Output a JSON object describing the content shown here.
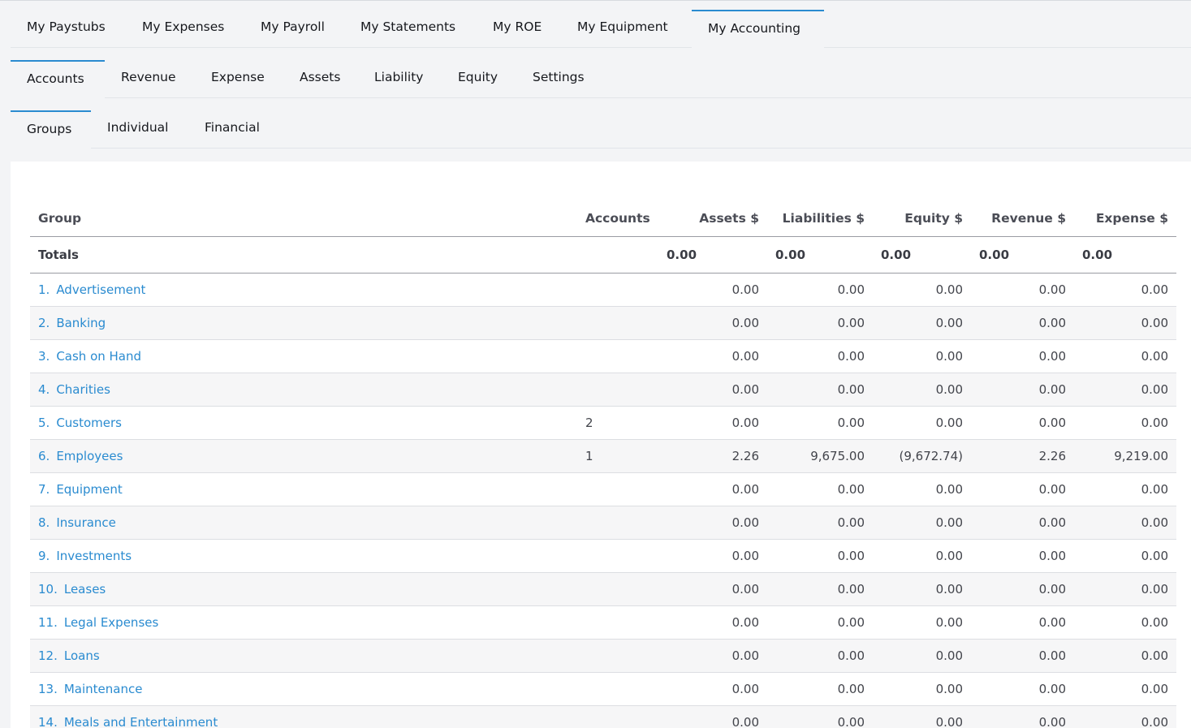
{
  "tabs_primary": [
    {
      "label": "My Paystubs"
    },
    {
      "label": "My Expenses"
    },
    {
      "label": "My Payroll"
    },
    {
      "label": "My Statements"
    },
    {
      "label": "My ROE"
    },
    {
      "label": "My Equipment"
    },
    {
      "label": "My Accounting",
      "active": true
    }
  ],
  "tabs_secondary": [
    {
      "label": "Accounts",
      "active": true
    },
    {
      "label": "Revenue"
    },
    {
      "label": "Expense"
    },
    {
      "label": "Assets"
    },
    {
      "label": "Liability"
    },
    {
      "label": "Equity"
    },
    {
      "label": "Settings"
    }
  ],
  "tabs_tertiary": [
    {
      "label": "Groups",
      "active": true
    },
    {
      "label": "Individual"
    },
    {
      "label": "Financial"
    }
  ],
  "table": {
    "headers": {
      "group": "Group",
      "accounts": "Accounts",
      "assets": "Assets $",
      "liabilities": "Liabilities $",
      "equity": "Equity $",
      "revenue": "Revenue $",
      "expense": "Expense $"
    },
    "totals": {
      "label": "Totals",
      "assets": "0.00",
      "liabilities": "0.00",
      "equity": "0.00",
      "revenue": "0.00",
      "expense": "0.00"
    },
    "rows": [
      {
        "num": "1.",
        "name": "Advertisement",
        "accounts": "",
        "assets": "0.00",
        "liabilities": "0.00",
        "equity": "0.00",
        "revenue": "0.00",
        "expense": "0.00"
      },
      {
        "num": "2.",
        "name": "Banking",
        "accounts": "",
        "assets": "0.00",
        "liabilities": "0.00",
        "equity": "0.00",
        "revenue": "0.00",
        "expense": "0.00"
      },
      {
        "num": "3.",
        "name": "Cash on Hand",
        "accounts": "",
        "assets": "0.00",
        "liabilities": "0.00",
        "equity": "0.00",
        "revenue": "0.00",
        "expense": "0.00"
      },
      {
        "num": "4.",
        "name": "Charities",
        "accounts": "",
        "assets": "0.00",
        "liabilities": "0.00",
        "equity": "0.00",
        "revenue": "0.00",
        "expense": "0.00"
      },
      {
        "num": "5.",
        "name": "Customers",
        "accounts": "2",
        "assets": "0.00",
        "liabilities": "0.00",
        "equity": "0.00",
        "revenue": "0.00",
        "expense": "0.00"
      },
      {
        "num": "6.",
        "name": "Employees",
        "accounts": "1",
        "assets": "2.26",
        "liabilities": "9,675.00",
        "equity": "(9,672.74)",
        "equity_negative": true,
        "revenue": "2.26",
        "expense": "9,219.00"
      },
      {
        "num": "7.",
        "name": "Equipment",
        "accounts": "",
        "assets": "0.00",
        "liabilities": "0.00",
        "equity": "0.00",
        "revenue": "0.00",
        "expense": "0.00"
      },
      {
        "num": "8.",
        "name": "Insurance",
        "accounts": "",
        "assets": "0.00",
        "liabilities": "0.00",
        "equity": "0.00",
        "revenue": "0.00",
        "expense": "0.00"
      },
      {
        "num": "9.",
        "name": "Investments",
        "accounts": "",
        "assets": "0.00",
        "liabilities": "0.00",
        "equity": "0.00",
        "revenue": "0.00",
        "expense": "0.00"
      },
      {
        "num": "10.",
        "name": "Leases",
        "accounts": "",
        "assets": "0.00",
        "liabilities": "0.00",
        "equity": "0.00",
        "revenue": "0.00",
        "expense": "0.00"
      },
      {
        "num": "11.",
        "name": "Legal Expenses",
        "accounts": "",
        "assets": "0.00",
        "liabilities": "0.00",
        "equity": "0.00",
        "revenue": "0.00",
        "expense": "0.00"
      },
      {
        "num": "12.",
        "name": "Loans",
        "accounts": "",
        "assets": "0.00",
        "liabilities": "0.00",
        "equity": "0.00",
        "revenue": "0.00",
        "expense": "0.00"
      },
      {
        "num": "13.",
        "name": "Maintenance",
        "accounts": "",
        "assets": "0.00",
        "liabilities": "0.00",
        "equity": "0.00",
        "revenue": "0.00",
        "expense": "0.00"
      },
      {
        "num": "14.",
        "name": "Meals and Entertainment",
        "accounts": "",
        "assets": "0.00",
        "liabilities": "0.00",
        "equity": "0.00",
        "revenue": "0.00",
        "expense": "0.00"
      }
    ]
  },
  "colors": {
    "link": "#2a8bd0",
    "negative": "#e0282c",
    "active_tab_border": "#2a8bd0",
    "background": "#f3f4f6"
  }
}
